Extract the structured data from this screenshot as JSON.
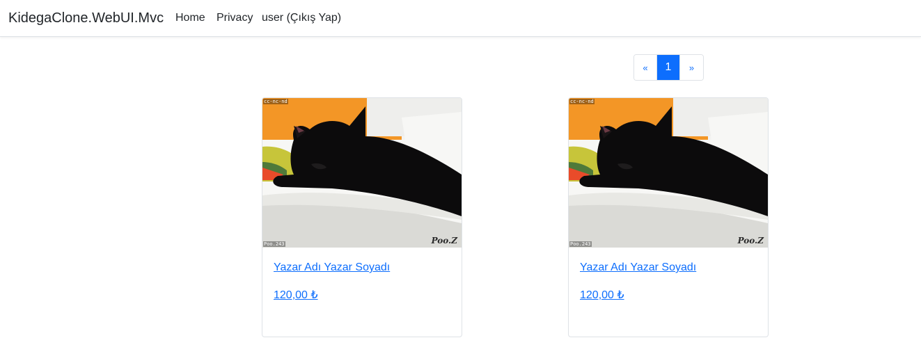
{
  "navbar": {
    "brand": "KidegaClone.WebUI.Mvc",
    "links": [
      {
        "label": "Home"
      },
      {
        "label": "Privacy"
      },
      {
        "label": "user (Çıkış Yap)"
      }
    ]
  },
  "pagination": {
    "prev": "«",
    "current": "1",
    "next": "»"
  },
  "products": [
    {
      "title": "Yazar Adı Yazar Soyadı",
      "price": "120,00 ₺",
      "image": {
        "license_mark": "cc-nc-nd",
        "author_mark": "Poo.243",
        "signature": "Poo.Z"
      }
    },
    {
      "title": "Yazar Adı Yazar Soyadı",
      "price": "120,00 ₺",
      "image": {
        "license_mark": "cc-nc-nd",
        "author_mark": "Poo.243",
        "signature": "Poo.Z"
      }
    }
  ],
  "colors": {
    "link": "#0d6efd",
    "active_page_bg": "#0d6efd",
    "border": "#dee2e6"
  }
}
